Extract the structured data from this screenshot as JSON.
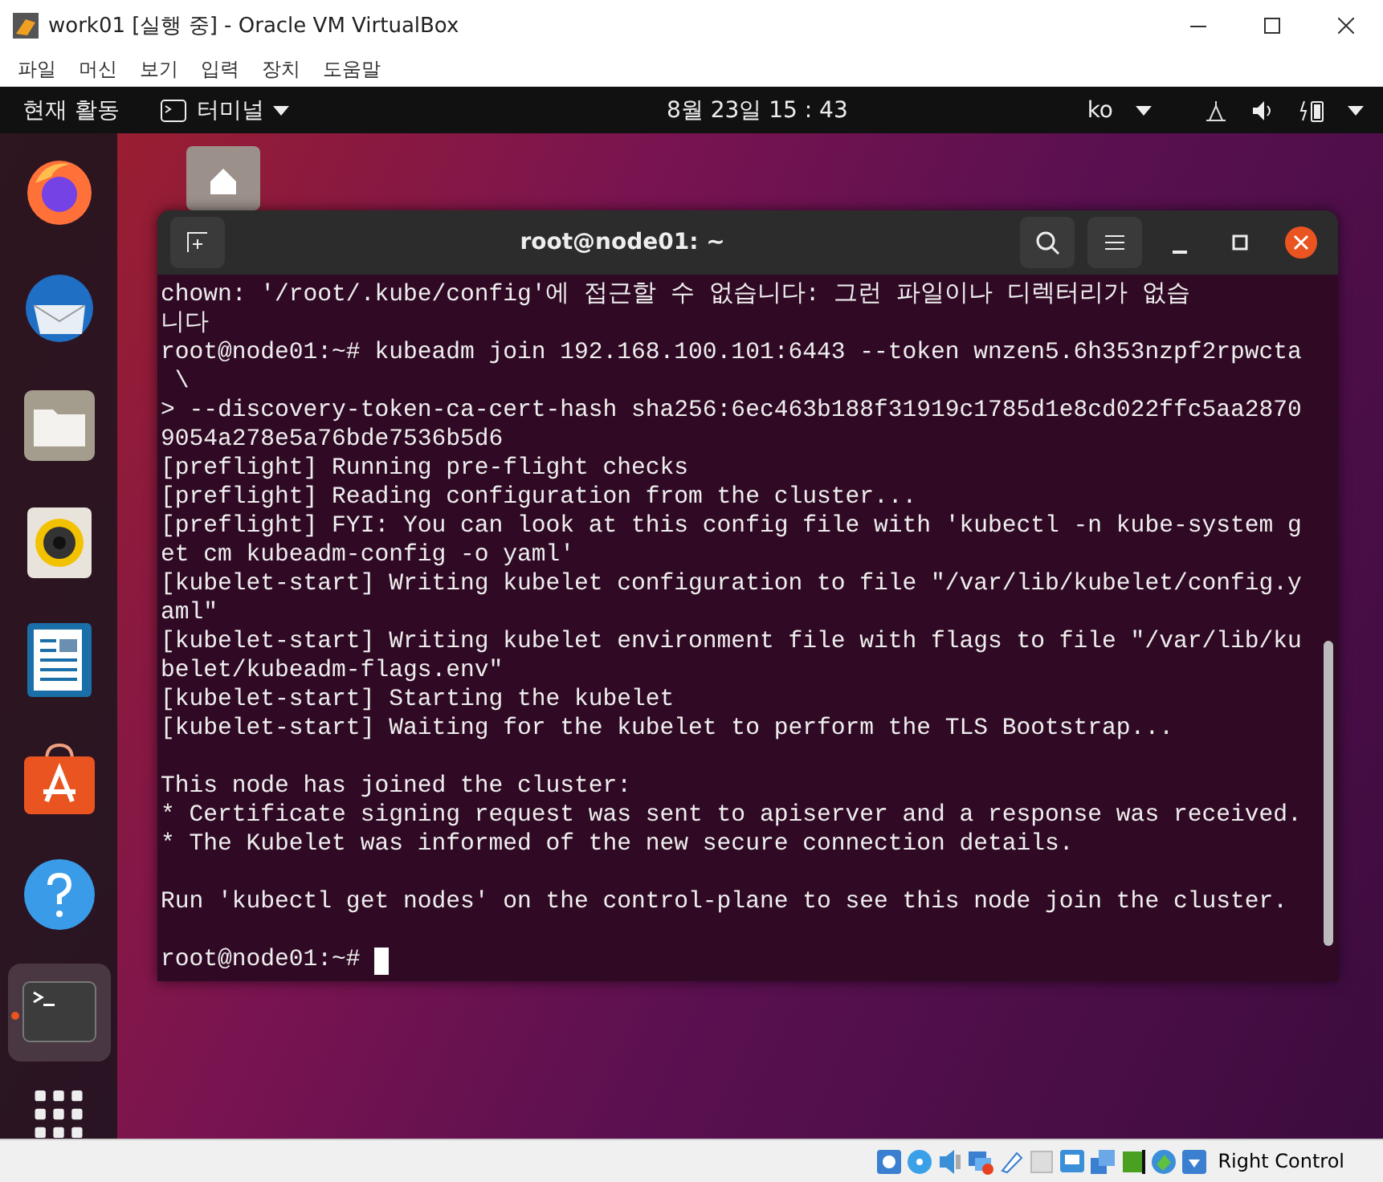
{
  "window": {
    "title": "work01 [실행 중] - Oracle VM VirtualBox"
  },
  "menu": [
    "파일",
    "머신",
    "보기",
    "입력",
    "장치",
    "도움말"
  ],
  "topbar": {
    "activities": "현재 활동",
    "app": "터미널",
    "clock": "8월 23일  15 : 43",
    "language": "ko"
  },
  "dock": [
    {
      "kind": "firefox",
      "running": false
    },
    {
      "kind": "thunderbird",
      "running": false
    },
    {
      "kind": "files",
      "running": false
    },
    {
      "kind": "rhythmbox",
      "running": false
    },
    {
      "kind": "writer",
      "running": false
    },
    {
      "kind": "software",
      "running": false
    },
    {
      "kind": "help",
      "running": false
    },
    {
      "kind": "terminal",
      "running": true
    }
  ],
  "terminal": {
    "title": "root@node01: ~",
    "cursor": true,
    "lines": [
      "chown: '/root/.kube/config'에 접근할 수 없습니다: 그런 파일이나 디렉터리가 없습",
      "니다",
      "root@node01:~# kubeadm join 192.168.100.101:6443 --token wnzen5.6h353nzpf2rpwcta",
      " \\",
      "> --discovery-token-ca-cert-hash sha256:6ec463b188f31919c1785d1e8cd022ffc5aa2870",
      "9054a278e5a76bde7536b5d6",
      "[preflight] Running pre-flight checks",
      "[preflight] Reading configuration from the cluster...",
      "[preflight] FYI: You can look at this config file with 'kubectl -n kube-system g",
      "et cm kubeadm-config -o yaml'",
      "[kubelet-start] Writing kubelet configuration to file \"/var/lib/kubelet/config.y",
      "aml\"",
      "[kubelet-start] Writing kubelet environment file with flags to file \"/var/lib/ku",
      "belet/kubeadm-flags.env\"",
      "[kubelet-start] Starting the kubelet",
      "[kubelet-start] Waiting for the kubelet to perform the TLS Bootstrap...",
      {
        "kind": "blank"
      },
      "This node has joined the cluster:",
      "* Certificate signing request was sent to apiserver and a response was received.",
      "* The Kubelet was informed of the new secure connection details.",
      {
        "kind": "blank"
      },
      "Run 'kubectl get nodes' on the control-plane to see this node join the cluster.",
      {
        "kind": "blank"
      },
      "root@node01:~# "
    ]
  },
  "statusbar": {
    "host_key": "Right Control"
  }
}
